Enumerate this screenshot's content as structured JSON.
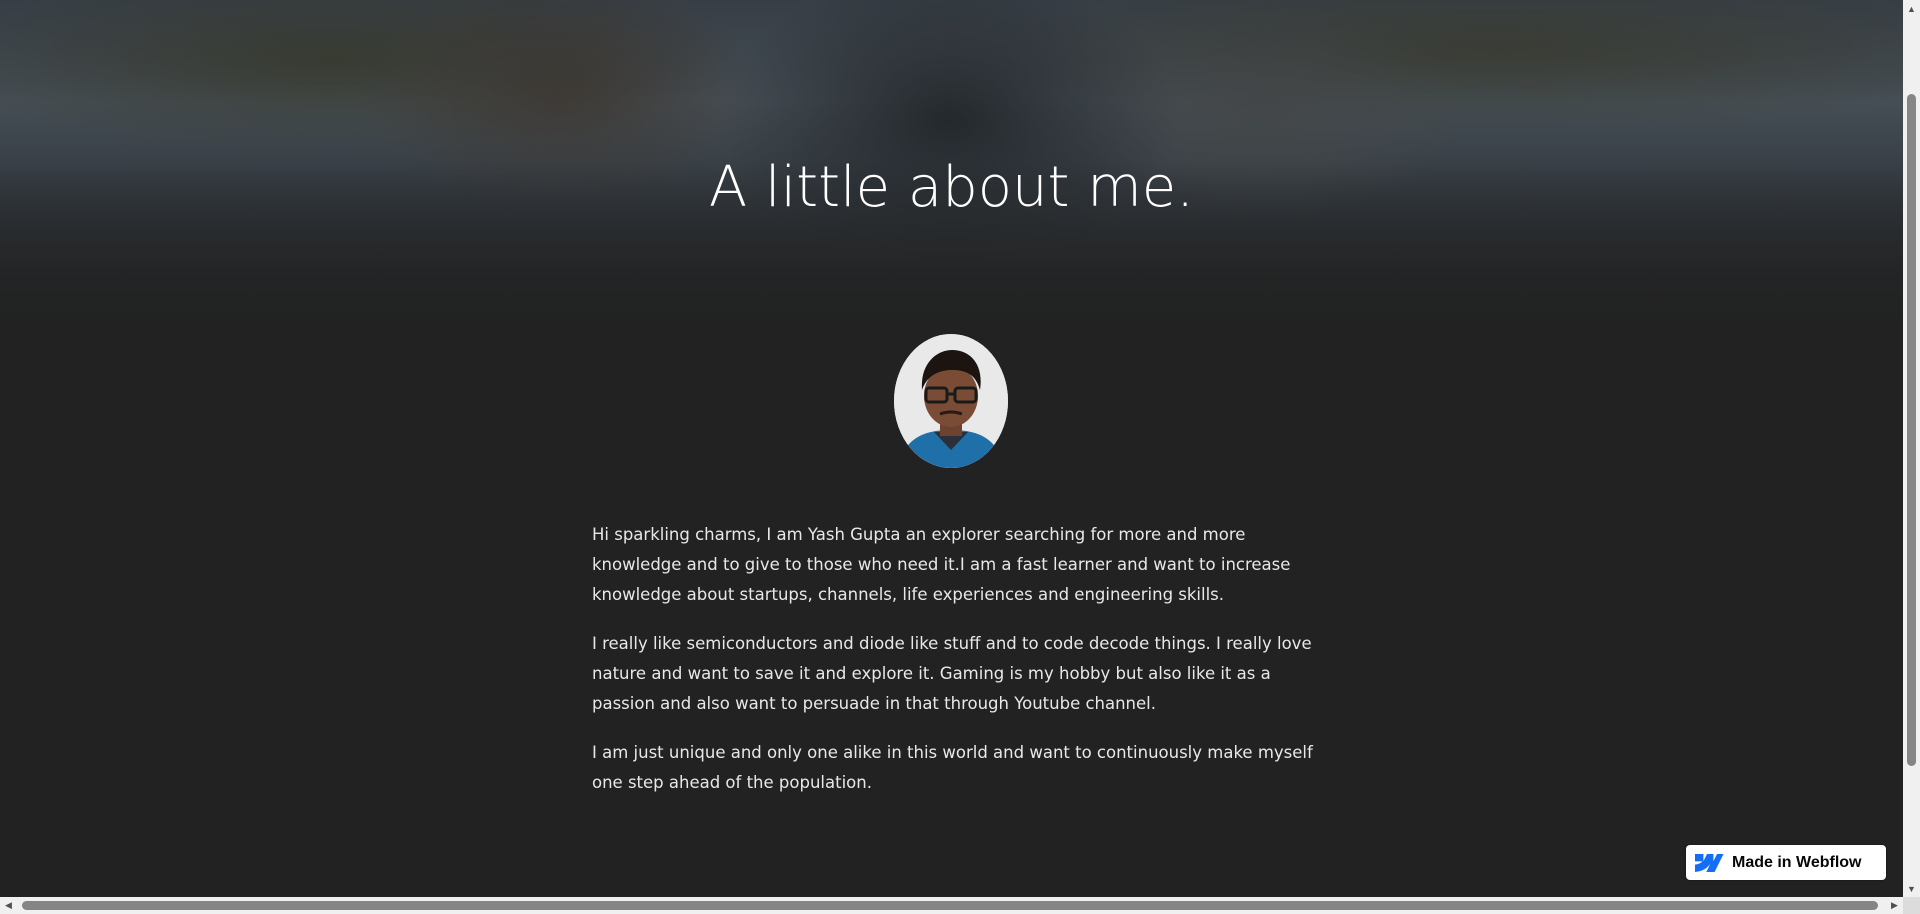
{
  "hero": {
    "title": "A little about me."
  },
  "avatar": {
    "icon": "portrait-avatar"
  },
  "bio": {
    "paragraphs": [
      "Hi sparkling charms, I am Yash Gupta an explorer searching for more and more knowledge and to give to those who need it.I am a fast learner and want to increase knowledge about startups, channels, life experiences and engineering skills.",
      "I really like semiconductors and diode like stuff and to code decode things. I really love nature and want to save it and explore it. Gaming is my hobby but also like it as a passion and also want to persuade in that through Youtube channel.",
      "I am just unique and only one alike in this world and want to continuously make myself one step ahead of the population."
    ]
  },
  "badge": {
    "label": "Made in Webflow",
    "icon": "webflow-logo-icon",
    "brand_color": "#146EF5"
  },
  "colors": {
    "background": "#222222",
    "text": "#e8e8e8",
    "title": "#ffffff"
  }
}
